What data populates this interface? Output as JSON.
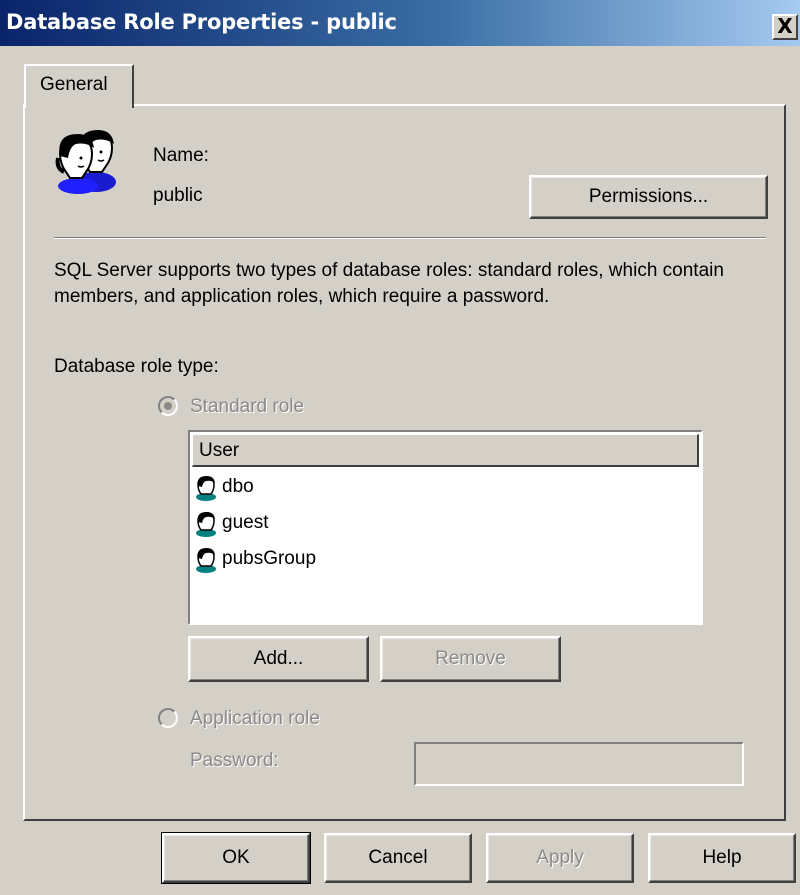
{
  "window": {
    "title": "Database Role Properties - public",
    "close_label": "X"
  },
  "tabs": [
    {
      "label": "General"
    }
  ],
  "header": {
    "name_label": "Name:",
    "name_value": "public",
    "icon": "role-users-icon",
    "permissions_label": "Permissions..."
  },
  "description": "SQL Server supports two types of database roles: standard roles, which contain members, and application roles, which require a password.",
  "role_type": {
    "label": "Database role type:",
    "standard_label": "Standard role",
    "standard_selected": true,
    "application_label": "Application role",
    "application_selected": false,
    "password_label": "Password:",
    "password_value": ""
  },
  "members": {
    "column_header": "User",
    "rows": [
      {
        "name": "dbo",
        "icon": "user-icon"
      },
      {
        "name": "guest",
        "icon": "user-icon"
      },
      {
        "name": "pubsGroup",
        "icon": "user-icon"
      }
    ],
    "add_label": "Add...",
    "remove_label": "Remove"
  },
  "footer": {
    "ok_label": "OK",
    "cancel_label": "Cancel",
    "apply_label": "Apply",
    "help_label": "Help"
  }
}
